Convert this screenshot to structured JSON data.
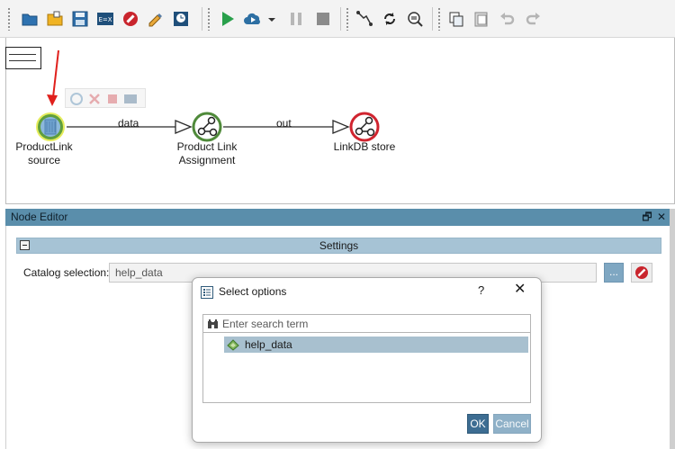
{
  "toolbar": {
    "icons": [
      "folder-icon",
      "open-icon",
      "save-icon",
      "export-icon",
      "stop-icon",
      "edit-icon",
      "schedule-icon",
      "run-icon",
      "run-cloud-icon",
      "dropdown-icon",
      "pause-icon",
      "stop-square-icon",
      "path-icon",
      "refresh-icon",
      "inspect-icon",
      "copy-icon",
      "paste-icon",
      "undo-icon",
      "redo-icon"
    ],
    "colors": {
      "run": "#29a04b",
      "stop": "#c9252d",
      "cloud": "#2d6fa3"
    }
  },
  "workflow": {
    "nodes": [
      {
        "label": "ProductLink source",
        "label_lines": [
          "ProductLink",
          "source"
        ],
        "ring_color": "#4f8a3a",
        "fill_color": "#7eaed4"
      },
      {
        "label": "Product Link Assignment",
        "label_lines": [
          "Product Link",
          "Assignment"
        ],
        "ring_color": "#4f8a3a"
      },
      {
        "label": "LinkDB store",
        "label_lines": [
          "LinkDB store"
        ],
        "ring_color": "#d0242f"
      }
    ],
    "edges": [
      {
        "label": "data"
      },
      {
        "label": "out"
      }
    ],
    "annotation_arrow_color": "#e0201c"
  },
  "node_editor": {
    "title": "Node Editor",
    "restore_symbol": "🗗",
    "close_symbol": "✕",
    "settings_title": "Settings",
    "catalog_label": "Catalog selection:",
    "catalog_value": "help_data",
    "browse_label": "..."
  },
  "dialog": {
    "title": "Select options",
    "help_symbol": "?",
    "close_symbol": "✕",
    "search_placeholder": "Enter search term",
    "items": [
      {
        "label": "help_data",
        "selected": true
      }
    ],
    "ok_label": "OK",
    "cancel_label": "Cancel"
  }
}
